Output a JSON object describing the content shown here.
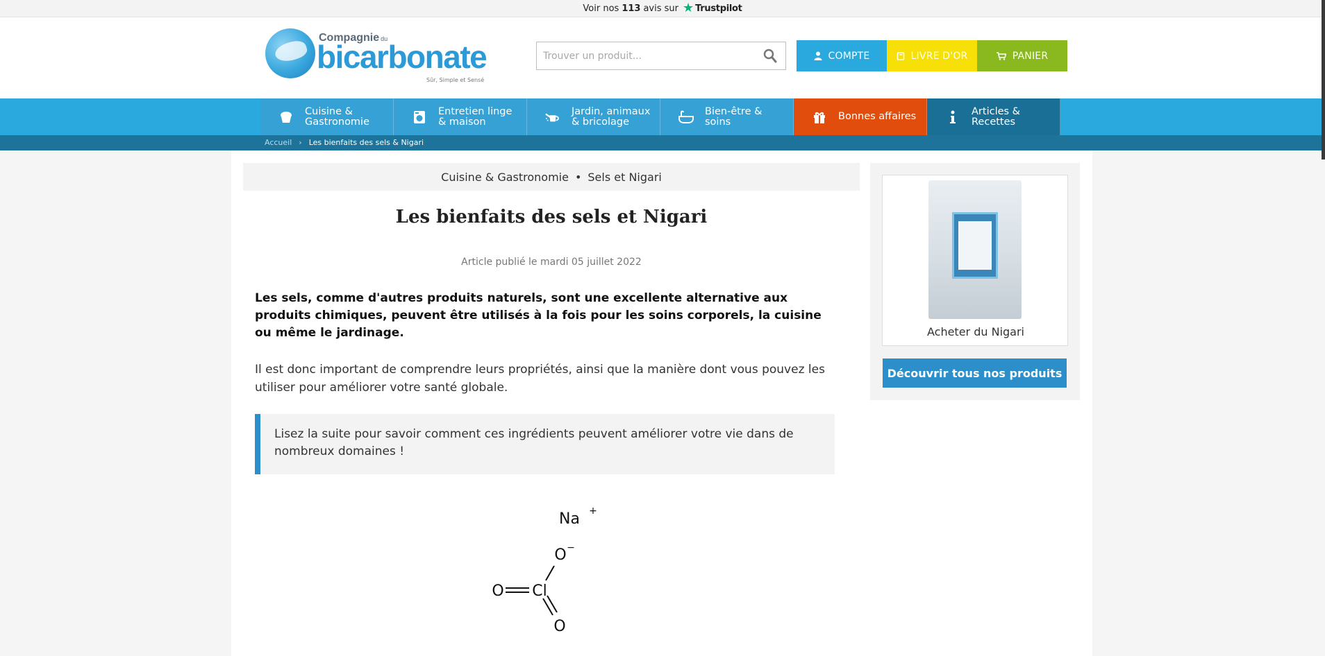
{
  "topbar": {
    "prefix": "Voir nos",
    "count": "113",
    "suffix": "avis sur",
    "brand": "Trustpilot"
  },
  "logo": {
    "company": "Compagnie",
    "du": "du",
    "name": "bicarbonate",
    "tagline": "Sûr, Simple et Sensé"
  },
  "search": {
    "placeholder": "Trouver un produit...",
    "value": ""
  },
  "header_buttons": {
    "account": "COMPTE",
    "guestbook": "LIVRE D'OR",
    "cart": "PANIER"
  },
  "nav": {
    "items": [
      {
        "line1": "Cuisine &",
        "line2": "Gastronomie",
        "icon": "cupcake-icon"
      },
      {
        "line1": "Entretien linge",
        "line2": "& maison",
        "icon": "washing-machine-icon"
      },
      {
        "line1": "Jardin, animaux",
        "line2": "& bricolage",
        "icon": "watering-can-icon"
      },
      {
        "line1": "Bien-être &",
        "line2": "soins",
        "icon": "bathtub-icon"
      },
      {
        "line1": "Bonnes affaires",
        "line2": "",
        "icon": "gift-icon"
      },
      {
        "line1": "Articles &",
        "line2": "Recettes",
        "icon": "info-icon"
      }
    ]
  },
  "breadcrumb": {
    "home": "Accueil",
    "separator": "›",
    "current": "Les bienfaits des sels & Nigari"
  },
  "article": {
    "category": "Cuisine & Gastronomie",
    "dot": "•",
    "subcategory": "Sels et Nigari",
    "title": "Les bienfaits des sels et Nigari",
    "published": "Article publié le mardi 05 juillet 2022",
    "lead": "Les sels, comme d'autres produits naturels, sont une excellente alternative aux produits chimiques, peuvent être utilisés à la fois pour les soins corporels, la cuisine ou même le jardinage.",
    "paragraph": "Il est donc important de comprendre leurs propriétés, ainsi que la manière dont vous pouvez les utiliser pour améliorer votre santé globale.",
    "quote": "Lisez la suite pour savoir comment ces ingrédients peuvent améliorer votre vie dans de nombreux domaines !"
  },
  "molecule": {
    "cation": "Na",
    "cation_charge": "+",
    "atoms": {
      "o_minus": "O",
      "o_minus_charge": "−",
      "cl": "Cl",
      "o_left": "O",
      "o_bottom": "O"
    }
  },
  "sidebar": {
    "product_name": "Acheter du Nigari",
    "discover_button": "Découvrir tous nos produits"
  },
  "colors": {
    "brand_blue": "#2aa9de",
    "guestbook_yellow": "#f6e007",
    "cart_green": "#8ab91f",
    "deals_orange": "#e14d0c",
    "articles_dark": "#1a6f97",
    "button_blue": "#2c8fca",
    "trustpilot_green": "#00b67a"
  }
}
